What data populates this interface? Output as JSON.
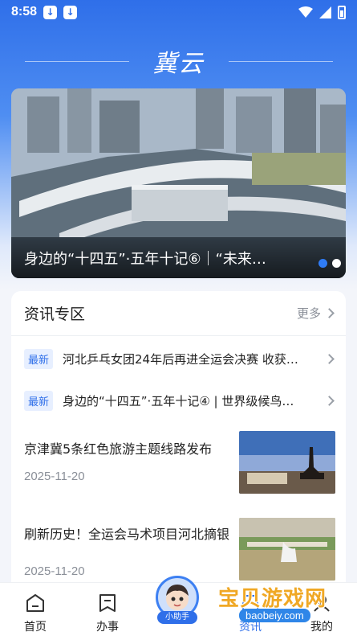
{
  "status": {
    "time": "8:58",
    "left_icons": [
      "download-icon",
      "download-icon"
    ],
    "right_icons": [
      "wifi-icon",
      "signal-icon",
      "battery-icon"
    ]
  },
  "brand": {
    "logo_text": "冀云"
  },
  "banner": {
    "title": "身边的“十四五”·五年十记⑥｜“未来…",
    "dots": 2,
    "active_dot": 0
  },
  "news_section": {
    "title": "资讯专区",
    "more_label": "更多",
    "hot_items": [
      {
        "tag": "最新",
        "text": "河北乒乓女团24年后再进全运会决赛 收获…"
      },
      {
        "tag": "最新",
        "text": "身边的“十四五”·五年十记④ | 世界级候鸟…"
      }
    ],
    "articles": [
      {
        "title": "京津冀5条红色旅游主题线路发布",
        "date": "2025-11-20"
      },
      {
        "title": "刷新历史！全运会马术项目河北摘银",
        "date": "2025-11-20"
      }
    ]
  },
  "tabbar": {
    "tabs": [
      {
        "label": "首页",
        "icon": "home-icon"
      },
      {
        "label": "办事",
        "icon": "bookmark-icon"
      },
      {
        "label": "资讯",
        "icon": "news-icon"
      },
      {
        "label": "我的",
        "icon": "user-icon"
      }
    ],
    "assistant_label": "小助手",
    "active_index": 2
  },
  "watermark": {
    "main": "宝贝游戏网",
    "sub": "baobeiy.com"
  },
  "colors": {
    "accent": "#2f6fe9",
    "tag_bg": "#e7efff",
    "watermark": "#f0a825"
  }
}
